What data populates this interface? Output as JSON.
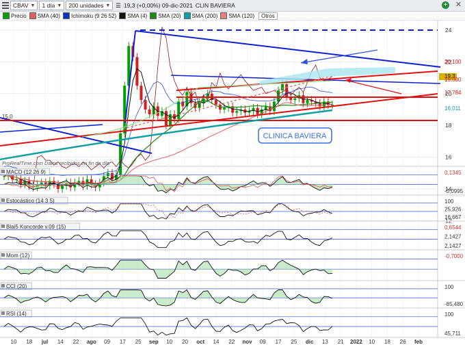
{
  "toolbar": {
    "symbol": "CBAV",
    "period": "1 día",
    "units": "200 unidades",
    "quote": "19,3 (+0,00%) 09-dic-2021",
    "name": "CLIN BAVIERA"
  },
  "legend": [
    {
      "label": "Precio",
      "color": "#00a000"
    },
    {
      "label": "SMA (40)",
      "color": "#e06060"
    },
    {
      "label": "Ichimoku (9 26 52)",
      "color": "#1030c0"
    },
    {
      "label": "SMA (4)",
      "color": "#111111"
    },
    {
      "label": "SMA (20)",
      "color": "#1a8a1a"
    },
    {
      "label": "SMA (200)",
      "color": "#10a0a0"
    },
    {
      "label": "SMA (120)",
      "color": "#e08080"
    }
  ],
  "legend_other": "Otros",
  "watermark": "ProRealTime.com  Datos recibidos en fin de día",
  "annotation": "CLINICA BAVIERA",
  "colors": {
    "bull": "#00a000",
    "bear": "#d02020",
    "trend_blue": "#1020d0",
    "trend_red": "#e01010",
    "sma200": "#10a0a0",
    "sma20": "#1a8a1a"
  },
  "chart_data": [
    {
      "type": "candlestick",
      "title": "CBAV",
      "x_tick_labels": [
        "10",
        "18",
        "jul",
        "14",
        "22",
        "ago",
        "09",
        "17",
        "25",
        "sep",
        "10",
        "20",
        "oct",
        "14",
        "22",
        "nov",
        "09",
        "17",
        "25",
        "dic",
        "13",
        "21",
        "2022",
        "10",
        "18",
        "26",
        "feb"
      ],
      "y_ticks": [
        12,
        14,
        16,
        18,
        20,
        22,
        24
      ],
      "ylim": [
        11,
        25
      ],
      "price_labels": [
        {
          "text": "20,100",
          "color": "#e01010"
        },
        {
          "text": "19,3",
          "color": "#d8b000"
        },
        {
          "text": "19,000",
          "color": "#e01010"
        },
        {
          "text": "17,784",
          "color": "#e01010"
        },
        {
          "text": "16,011",
          "color": "#10a0a0"
        }
      ],
      "left_label": "15,0",
      "close_series": [
        14.8,
        14.9,
        14.6,
        14.6,
        14.3,
        14.5,
        14.2,
        14.1,
        14.3,
        14.4,
        14.2,
        14.5,
        14.3,
        14.0,
        14.2,
        14.4,
        14.1,
        14.4,
        14.5,
        14.2,
        14.6,
        14.3,
        14.1,
        14.4,
        14.8,
        15.0,
        14.6,
        14.9,
        17.5,
        20.5,
        23.0,
        22.3,
        20.5,
        19.6,
        19.0,
        18.7,
        19.2,
        18.6,
        18.9,
        18.0,
        18.7,
        18.4,
        19.5,
        19.2,
        20.1,
        19.4,
        19.1,
        19.4,
        19.7,
        20.0,
        19.6,
        19.3,
        19.0,
        19.1,
        19.2,
        18.8,
        18.9,
        19.0,
        18.8,
        18.9,
        19.1,
        18.7,
        19.0,
        19.2,
        18.9,
        19.5,
        20.2,
        20.6,
        19.8,
        19.6,
        19.7,
        19.9,
        19.4,
        19.6,
        19.5,
        19.4,
        19.2,
        19.5,
        19.3,
        19.3
      ]
    },
    {
      "type": "line",
      "title": "MACD (12 26 9)",
      "value_labels": [
        "0,1345",
        "-0,0995"
      ]
    },
    {
      "type": "line",
      "title": "Estocástico (14 3 5)",
      "value_labels": [
        "100",
        "25,926",
        "16,667"
      ]
    },
    {
      "type": "line",
      "title": "Blai5 Koncorde v.09 (15)",
      "value_labels": [
        "0,6544",
        "2,1427",
        "2,1427"
      ]
    },
    {
      "type": "line",
      "title": "Mom (12)",
      "value_labels": [
        "-0,7000"
      ]
    },
    {
      "type": "line",
      "title": "CCI (20)",
      "value_labels": [
        "100",
        "-85,480"
      ]
    },
    {
      "type": "line",
      "title": "RSI (14)",
      "value_labels": [
        "100",
        "45,711"
      ]
    }
  ]
}
